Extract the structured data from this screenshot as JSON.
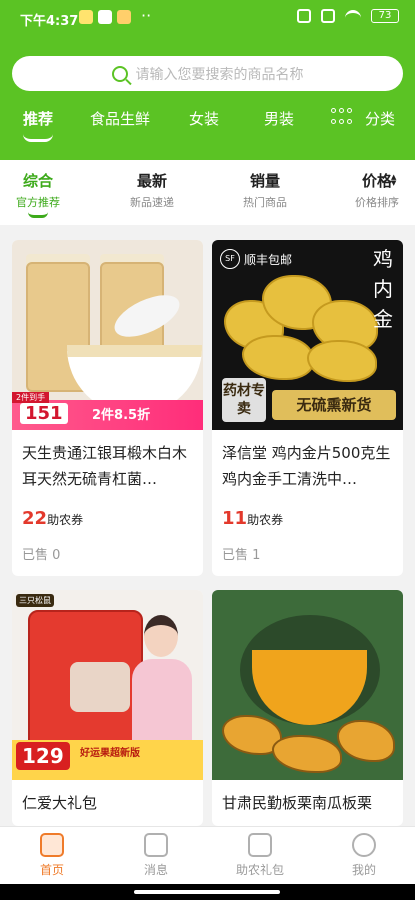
{
  "status_bar": {
    "time": "下午4:37",
    "battery": "73"
  },
  "search": {
    "placeholder": "请输入您要搜索的商品名称"
  },
  "category_tabs": [
    {
      "label": "推荐",
      "active": true
    },
    {
      "label": "食品生鲜"
    },
    {
      "label": "女装"
    },
    {
      "label": "男装"
    },
    {
      "label": "分类"
    }
  ],
  "sort_tabs": [
    {
      "label": "综合",
      "sub": "官方推荐",
      "active": true
    },
    {
      "label": "最新",
      "sub": "新品速递"
    },
    {
      "label": "销量",
      "sub": "热门商品"
    },
    {
      "label": "价格",
      "sub": "价格排序"
    }
  ],
  "products": [
    {
      "title": "天生贵通江银耳椴木白木耳天然无硫青杠菌…",
      "coupon_value": "22",
      "coupon_unit": "助农券",
      "sold": "已售 0",
      "img_text": {
        "price": "151",
        "deal": "2件8.5折",
        "tag": "2件到手"
      }
    },
    {
      "title": "泽信堂 鸡内金片500克生鸡内金手工清洗中…",
      "coupon_value": "11",
      "coupon_unit": "助农券",
      "sold": "已售 1",
      "img_text": {
        "badge": "顺丰包邮",
        "sf": "SF",
        "vertical": "鸡内金",
        "left_tag": "药材专卖",
        "right_tag": "无硫熏新货"
      }
    },
    {
      "title": "仁爱大礼包",
      "coupon_value": "",
      "coupon_unit": "",
      "sold": "",
      "img_text": {
        "price": "129",
        "promo": "好运果超新版",
        "label": "三只松鼠"
      }
    },
    {
      "title": "甘肃民勤板栗南瓜板栗",
      "coupon_value": "",
      "coupon_unit": "",
      "sold": ""
    }
  ],
  "bottom_tabs": [
    {
      "label": "首页",
      "icon": "home-icon",
      "active": true
    },
    {
      "label": "消息",
      "icon": "message-icon"
    },
    {
      "label": "助农礼包",
      "icon": "gift-icon"
    },
    {
      "label": "我的",
      "icon": "profile-icon"
    }
  ],
  "colors": {
    "brand_green": "#5bc324",
    "active_sort": "#3daa1b",
    "coupon_red": "#e3392c",
    "tab_active": "#ef7b2a"
  }
}
